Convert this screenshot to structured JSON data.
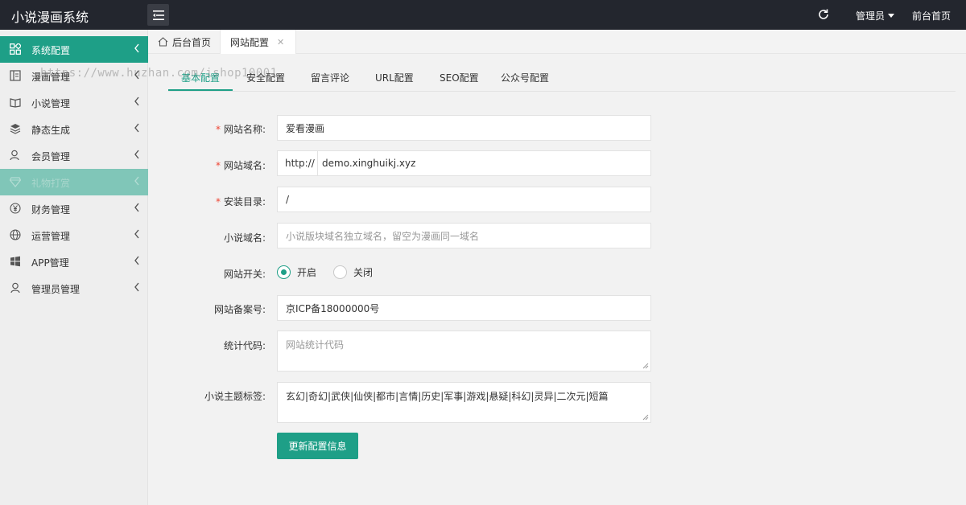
{
  "app": {
    "title": "小说漫画系统",
    "admin_label": "管理员",
    "front_label": "前台首页"
  },
  "sidebar": {
    "items": [
      {
        "label": "系统配置",
        "icon": "dashboard-icon",
        "state": "active"
      },
      {
        "label": "漫画管理",
        "icon": "comic-icon",
        "state": "normal"
      },
      {
        "label": "小说管理",
        "icon": "book-icon",
        "state": "normal"
      },
      {
        "label": "静态生成",
        "icon": "layers-icon",
        "state": "normal"
      },
      {
        "label": "会员管理",
        "icon": "user-icon",
        "state": "normal"
      },
      {
        "label": "礼物打赏",
        "icon": "gift-icon",
        "state": "hover"
      },
      {
        "label": "财务管理",
        "icon": "yen-icon",
        "state": "normal"
      },
      {
        "label": "运营管理",
        "icon": "globe-icon",
        "state": "normal"
      },
      {
        "label": "APP管理",
        "icon": "windows-icon",
        "state": "normal"
      },
      {
        "label": "管理员管理",
        "icon": "person-icon",
        "state": "normal"
      }
    ]
  },
  "tabs": {
    "home": "后台首页",
    "current": "网站配置"
  },
  "subtabs": [
    "基本配置",
    "安全配置",
    "留言评论",
    "URL配置",
    "SEO配置",
    "公众号配置"
  ],
  "watermark": "https://www.huzhan.com/ishop10001",
  "form": {
    "site_name": {
      "label": "网站名称:",
      "value": "爱看漫画",
      "required": true
    },
    "domain": {
      "label": "网站域名:",
      "prefix": "http://",
      "value": "demo.xinghuikj.xyz",
      "required": true
    },
    "install_dir": {
      "label": "安装目录:",
      "value": "/",
      "required": true
    },
    "novel_domain": {
      "label": "小说域名:",
      "placeholder": "小说版块域名独立域名，留空为漫画同一域名"
    },
    "site_switch": {
      "label": "网站开关:",
      "on": "开启",
      "off": "关闭",
      "selected": "on"
    },
    "icp": {
      "label": "网站备案号:",
      "value": "京ICP备18000000号"
    },
    "stats_code": {
      "label": "统计代码:",
      "placeholder": "网站统计代码"
    },
    "novel_tags": {
      "label": "小说主题标签:",
      "value": "玄幻|奇幻|武侠|仙侠|都市|言情|历史|军事|游戏|悬疑|科幻|灵异|二次元|短篇"
    },
    "submit": "更新配置信息"
  },
  "colors": {
    "accent": "#1e9f87",
    "header_bg": "#23262e",
    "sidebar_bg": "#eeeeee",
    "required": "#ee4433"
  }
}
